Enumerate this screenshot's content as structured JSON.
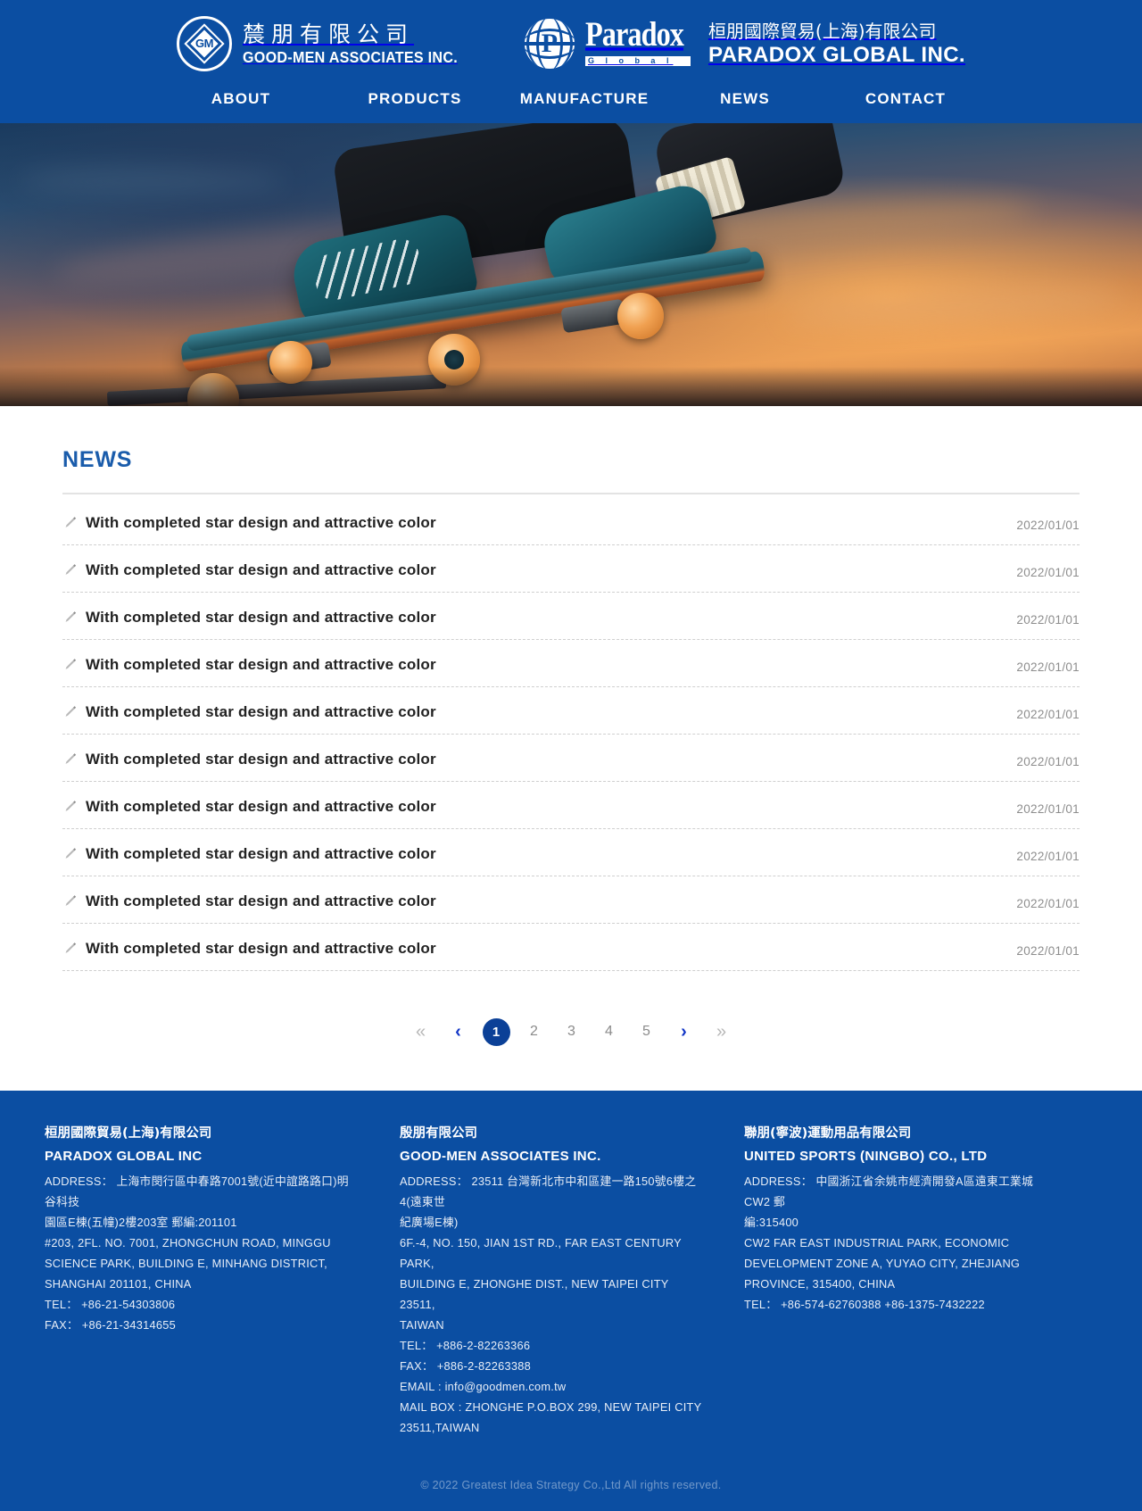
{
  "header": {
    "logos": [
      {
        "emblem_text": "GM",
        "cn_name": "辳朋有限公司",
        "en_name": "GOOD-MEN ASSOCIATES INC."
      },
      {
        "wordmark": "Paradox",
        "wordmark_sub": "G l o b a l",
        "cn_name": "桓朋國際貿易(上海)有限公司",
        "en_name": "PARADOX GLOBAL INC."
      }
    ],
    "nav": [
      {
        "label": "ABOUT"
      },
      {
        "label": "PRODUCTS"
      },
      {
        "label": "MANUFACTURE"
      },
      {
        "label": "NEWS"
      },
      {
        "label": "CONTACT"
      }
    ]
  },
  "hero": {
    "alt": "skateboarder mid-trick against orange sunset sky"
  },
  "main": {
    "page_title": "NEWS",
    "news": [
      {
        "title": "With completed star design and attractive color",
        "date": "2022/01/01"
      },
      {
        "title": "With completed star design and attractive color",
        "date": "2022/01/01"
      },
      {
        "title": "With completed star design and attractive color",
        "date": "2022/01/01"
      },
      {
        "title": "With completed star design and attractive color",
        "date": "2022/01/01"
      },
      {
        "title": "With completed star design and attractive color",
        "date": "2022/01/01"
      },
      {
        "title": "With completed star design and attractive color",
        "date": "2022/01/01"
      },
      {
        "title": "With completed star design and attractive color",
        "date": "2022/01/01"
      },
      {
        "title": "With completed star design and attractive color",
        "date": "2022/01/01"
      },
      {
        "title": "With completed star design and attractive color",
        "date": "2022/01/01"
      },
      {
        "title": "With completed star design and attractive color",
        "date": "2022/01/01"
      }
    ],
    "pagination": {
      "first": "«",
      "prev": "‹",
      "pages": [
        "1",
        "2",
        "3",
        "4",
        "5"
      ],
      "active_page": "1",
      "next": "›",
      "last": "»"
    }
  },
  "footer": {
    "columns": [
      {
        "cn_name": "桓朋國際貿易(上海)有限公司",
        "en_name": "PARADOX GLOBAL INC",
        "lines": [
          "ADDRESS： 上海市閔行區中春路7001號(近中誼路路口)明谷科技",
          "園區E棟(五幢)2樓203室 郵編:201101",
          "#203, 2FL. NO. 7001, ZHONGCHUN ROAD, MINGGU",
          "SCIENCE PARK, BUILDING E, MINHANG DISTRICT,",
          "SHANGHAI 201101, CHINA",
          "TEL： +86-21-54303806",
          "FAX： +86-21-34314655"
        ]
      },
      {
        "cn_name": "殷朋有限公司",
        "en_name": "GOOD-MEN ASSOCIATES INC.",
        "lines": [
          "ADDRESS： 23511 台灣新北市中和區建一路150號6樓之4(遠東世",
          "紀廣場E棟)",
          "6F.-4, NO. 150, JIAN 1ST RD., FAR EAST CENTURY PARK,",
          "BUILDING E, ZHONGHE DIST., NEW TAIPEI CITY 23511,",
          "TAIWAN",
          "TEL： +886-2-82263366",
          "FAX： +886-2-82263388",
          "EMAIL : info@goodmen.com.tw",
          "MAIL BOX : ZHONGHE P.O.BOX 299, NEW TAIPEI CITY",
          "23511,TAIWAN"
        ]
      },
      {
        "cn_name": "聯朋(寧波)運動用品有限公司",
        "en_name": "UNITED SPORTS (NINGBO) CO., LTD",
        "lines": [
          "ADDRESS： 中國浙江省余姚市經濟開發A區遠東工業城CW2 郵",
          "編:315400",
          "CW2 FAR EAST INDUSTRIAL PARK, ECONOMIC",
          "DEVELOPMENT ZONE A, YUYAO CITY, ZHEJIANG",
          "PROVINCE, 315400, CHINA",
          "TEL： +86-574-62760388 +86-1375-7432222"
        ]
      }
    ],
    "copyright": "© 2022 Greatest Idea Strategy Co.,Ltd All rights reserved."
  },
  "colors": {
    "brand_blue": "#0b4ea2",
    "title_blue": "#1a5cab",
    "pagination_active": "#0b4097",
    "pagination_arrow": "#1034c6",
    "news_title": "#222222",
    "news_date": "#8d8d8d"
  }
}
